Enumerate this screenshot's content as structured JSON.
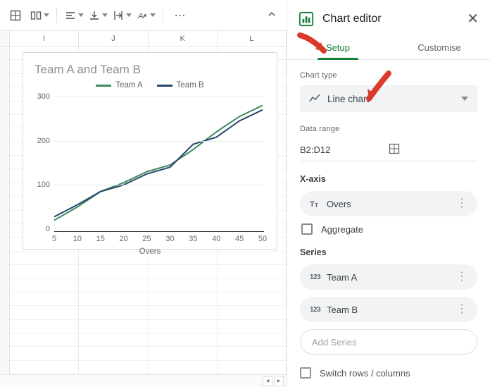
{
  "toolbar": {},
  "columns": [
    "I",
    "J",
    "K",
    "L"
  ],
  "chart_data": {
    "type": "line",
    "title": "Team A and Team B",
    "xlabel": "Overs",
    "ylabel": "",
    "ylim": [
      0,
      300
    ],
    "yticks": [
      0,
      100,
      200,
      300
    ],
    "x": [
      5,
      10,
      15,
      20,
      25,
      30,
      35,
      40,
      45,
      50
    ],
    "series": [
      {
        "name": "Team A",
        "color": "#3a8a5a",
        "values": [
          20,
          50,
          85,
          105,
          130,
          145,
          180,
          220,
          255,
          280
        ]
      },
      {
        "name": "Team B",
        "color": "#26466d",
        "values": [
          28,
          55,
          85,
          100,
          125,
          140,
          192,
          208,
          245,
          270
        ]
      }
    ]
  },
  "editor": {
    "title": "Chart editor",
    "tabs": {
      "setup": "Setup",
      "customise": "Customise"
    },
    "chart_type_label": "Chart type",
    "chart_type_value": "Line chart",
    "data_range_label": "Data range",
    "data_range_value": "B2:D12",
    "xaxis_label": "X-axis",
    "xaxis_value": "Overs",
    "aggregate_label": "Aggregate",
    "series_label": "Series",
    "series_items": [
      "Team A",
      "Team B"
    ],
    "add_series": "Add Series",
    "switch_label": "Switch rows / columns"
  }
}
